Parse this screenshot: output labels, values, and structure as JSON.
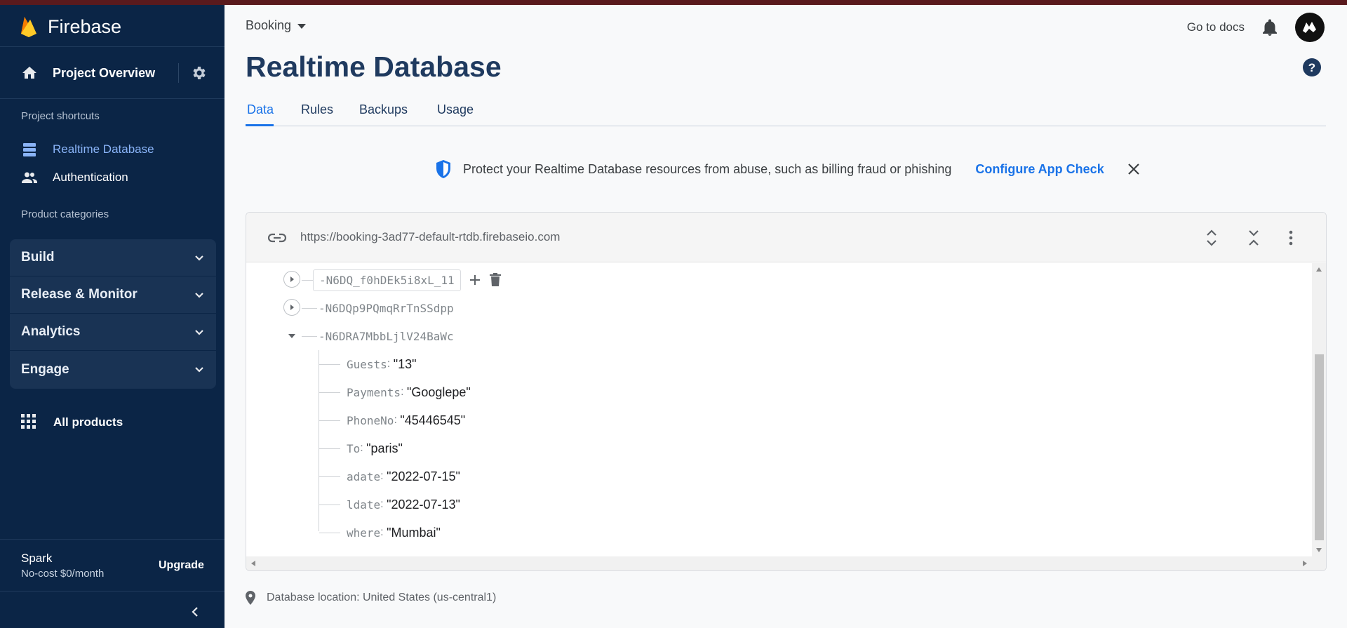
{
  "sidebar": {
    "brand": "Firebase",
    "overview_label": "Project Overview",
    "shortcuts_title": "Project shortcuts",
    "shortcuts": [
      {
        "label": "Realtime Database",
        "icon": "database-icon",
        "active": true
      },
      {
        "label": "Authentication",
        "icon": "people-icon",
        "active": false
      }
    ],
    "categories_title": "Product categories",
    "categories": [
      "Build",
      "Release & Monitor",
      "Analytics",
      "Engage"
    ],
    "all_products": "All products",
    "plan_name": "Spark",
    "plan_cost": "No-cost $0/month",
    "upgrade_label": "Upgrade",
    "active_color": "#8ab4f8",
    "bg_color": "#0b2546"
  },
  "header": {
    "project": "Booking",
    "docs": "Go to docs",
    "title": "Realtime Database"
  },
  "tabs": [
    "Data",
    "Rules",
    "Backups",
    "Usage"
  ],
  "banner": {
    "text": "Protect your Realtime Database resources from abuse, such as billing fraud or phishing",
    "link": "Configure App Check"
  },
  "database": {
    "url": "https://booking-3ad77-default-rtdb.firebaseio.com",
    "nodes": [
      {
        "key": "-N6DQ_f0hDEk5i8xL_11",
        "expanded": false,
        "selected": true
      },
      {
        "key": "-N6DQp9PQmqRrTnSSdpp",
        "expanded": false,
        "selected": false
      },
      {
        "key": "-N6DRA7MbbLjlV24BaWc",
        "expanded": true,
        "selected": false
      }
    ],
    "children": [
      {
        "key": "Guests",
        "value": "\"13\""
      },
      {
        "key": "Payments",
        "value": "\"Googlepe\""
      },
      {
        "key": "PhoneNo",
        "value": "\"45446545\""
      },
      {
        "key": "To",
        "value": "\"paris\""
      },
      {
        "key": "adate",
        "value": "\"2022-07-15\""
      },
      {
        "key": "ldate",
        "value": "\"2022-07-13\""
      },
      {
        "key": "where",
        "value": "\"Mumbai\""
      }
    ]
  },
  "footer": {
    "location": "Database location: United States (us-central1)"
  }
}
